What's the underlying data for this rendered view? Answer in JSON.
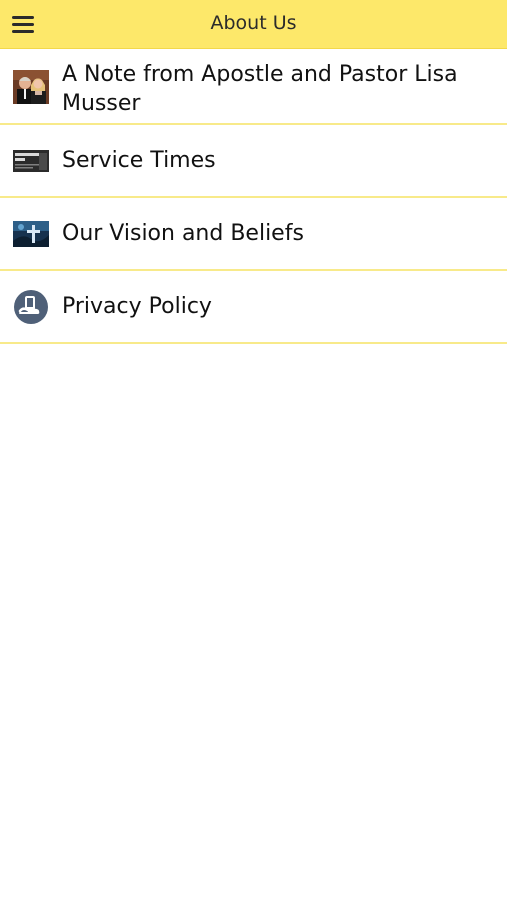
{
  "header": {
    "title": "About Us",
    "menu_icon": "hamburger-menu-icon",
    "background": "#fde86a"
  },
  "list": {
    "items": [
      {
        "label": "A Note from Apostle and Pastor Lisa Musser",
        "icon": "pastor-photo-thumbnail"
      },
      {
        "label": "Service Times",
        "icon": "service-times-thumbnail"
      },
      {
        "label": "Our Vision and Beliefs",
        "icon": "cross-vision-thumbnail"
      },
      {
        "label": "Privacy Policy",
        "icon": "privacy-policy-icon"
      }
    ],
    "divider_color": "#f8ea8a"
  }
}
